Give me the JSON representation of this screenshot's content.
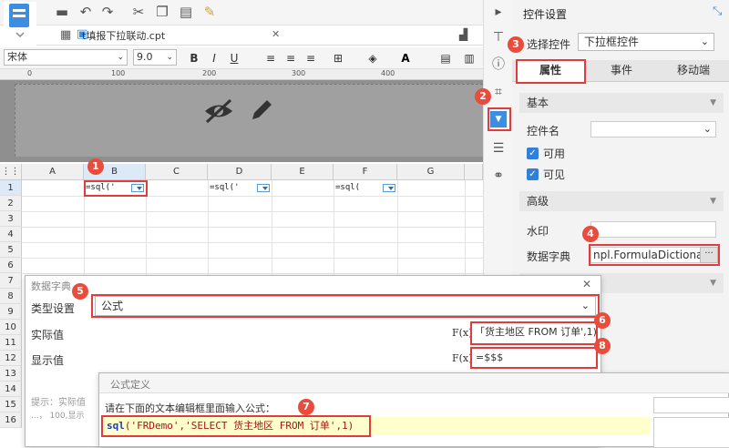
{
  "toolbar": {
    "file_tab": "t填报下拉联动.cpt",
    "font_name": "宋体",
    "font_size": "9.0",
    "ruler_marks": [
      "0",
      "100",
      "200",
      "300",
      "400"
    ]
  },
  "grid": {
    "columns": [
      "A",
      "B",
      "C",
      "D",
      "E",
      "F",
      "G"
    ],
    "rows": [
      "1",
      "2",
      "3",
      "4",
      "5",
      "6",
      "7",
      "8",
      "9",
      "10",
      "11",
      "12",
      "13",
      "14",
      "15",
      "16"
    ],
    "cells": {
      "b1": "=sql('",
      "d1": "=sql('",
      "f1": "=sql("
    }
  },
  "panel": {
    "title": "控件设置",
    "select_label": "选择控件",
    "select_value": "下拉框控件",
    "tabs": [
      "属性",
      "事件",
      "移动端"
    ],
    "section_basic": "基本",
    "widget_name_label": "控件名",
    "enabled_label": "可用",
    "visible_label": "可见",
    "section_advanced": "高级",
    "watermark_label": "水印",
    "dictionary_label": "数据字典",
    "dictionary_value": "npl.FormulaDictionary",
    "dots": "···"
  },
  "dict_dialog": {
    "title": "数据字典",
    "type_label": "类型设置",
    "type_value": "公式",
    "actual_label": "实际值",
    "actual_value": "「货主地区 FROM 订单',1)",
    "display_label": "显示值",
    "display_value": "=$$$",
    "fx": "F(x)",
    "hint_line1": "提示：实际值",
    "hint_line2": "...， 100,显示"
  },
  "formula_dialog": {
    "title": "公式定义",
    "prompt": "请在下面的文本编辑框里面输入公式：",
    "formula_keyword": "sql",
    "formula_rest": "('FRDemo','SELECT 货主地区 FROM 订单',1)"
  },
  "badges": [
    "1",
    "2",
    "3",
    "4",
    "5",
    "6",
    "7",
    "8"
  ],
  "colors": {
    "accent": "#2f7fdb",
    "highlight": "#e23b3b",
    "badge": "#e84c3d"
  }
}
